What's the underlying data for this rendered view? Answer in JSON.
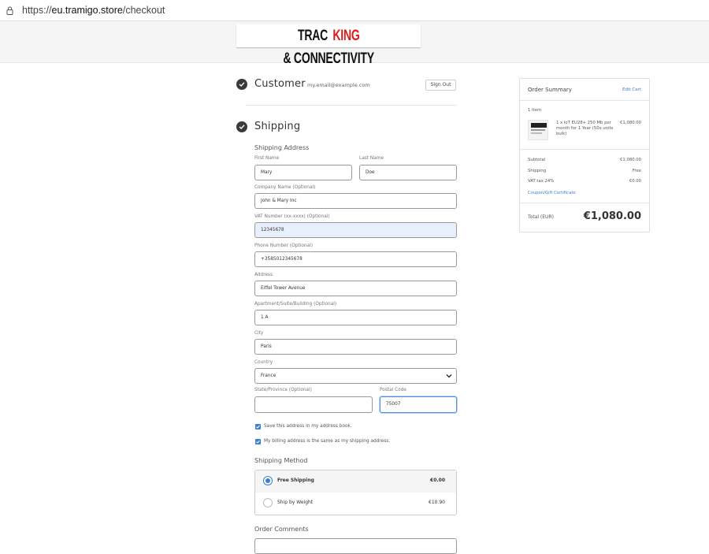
{
  "browser": {
    "url_prefix": "https://",
    "url_host": "eu.tramigo.store",
    "url_path": "/checkout"
  },
  "logo": {
    "part1": "TRAC",
    "part2": "KING",
    "part3": " & CONNECTIVITY"
  },
  "customer": {
    "title": "Customer",
    "email": "my.email@example.com",
    "sign_out": "Sign Out"
  },
  "shipping": {
    "title": "Shipping",
    "address_heading": "Shipping Address",
    "fields": {
      "first_name": {
        "label": "First Name",
        "value": "Mary"
      },
      "last_name": {
        "label": "Last Name",
        "value": "Doe"
      },
      "company": {
        "label": "Company Name (Optional)",
        "value": "John & Mary Inc"
      },
      "vat": {
        "label": "VAT Number (xx-xxxx) (Optional)",
        "value": "12345678"
      },
      "phone": {
        "label": "Phone Number (Optional)",
        "value": "+3585012345678"
      },
      "address": {
        "label": "Address",
        "value": "Eiffel Tower Avenue"
      },
      "apartment": {
        "label": "Apartment/Suite/Building (Optional)",
        "value": "1 A"
      },
      "city": {
        "label": "City",
        "value": "Paris"
      },
      "country": {
        "label": "Country",
        "value": "France"
      },
      "state": {
        "label": "State/Province (Optional)",
        "value": ""
      },
      "postal": {
        "label": "Postal Code",
        "value": "75007"
      }
    },
    "save_address": "Save this address in my address book.",
    "billing_same": "My billing address is the same as my shipping address.",
    "method_heading": "Shipping Method",
    "methods": [
      {
        "name": "Free Shipping",
        "price": "€0.00",
        "selected": true
      },
      {
        "name": "Ship by Weight",
        "price": "€10.90",
        "selected": false
      }
    ],
    "comments_heading": "Order Comments"
  },
  "summary": {
    "title": "Order Summary",
    "edit_cart": "Edit Cart",
    "items_count": "1 Item",
    "item": {
      "description": "1 x IoT EU28+ 250 Mb per month for 1 Year (50x units bulk)",
      "price": "€1,080.00"
    },
    "subtotal_label": "Subtotal",
    "subtotal": "€1,080.00",
    "shipping_label": "Shipping",
    "shipping": "Free",
    "vat_label": "VAT tax 24%",
    "vat": "€0.00",
    "coupon": "Coupon/Gift Certificate",
    "total_label": "Total (EUR)",
    "total": "€1,080.00"
  },
  "colors": {
    "accent": "#3b7ed4",
    "logo_red": "#e01b1b"
  }
}
